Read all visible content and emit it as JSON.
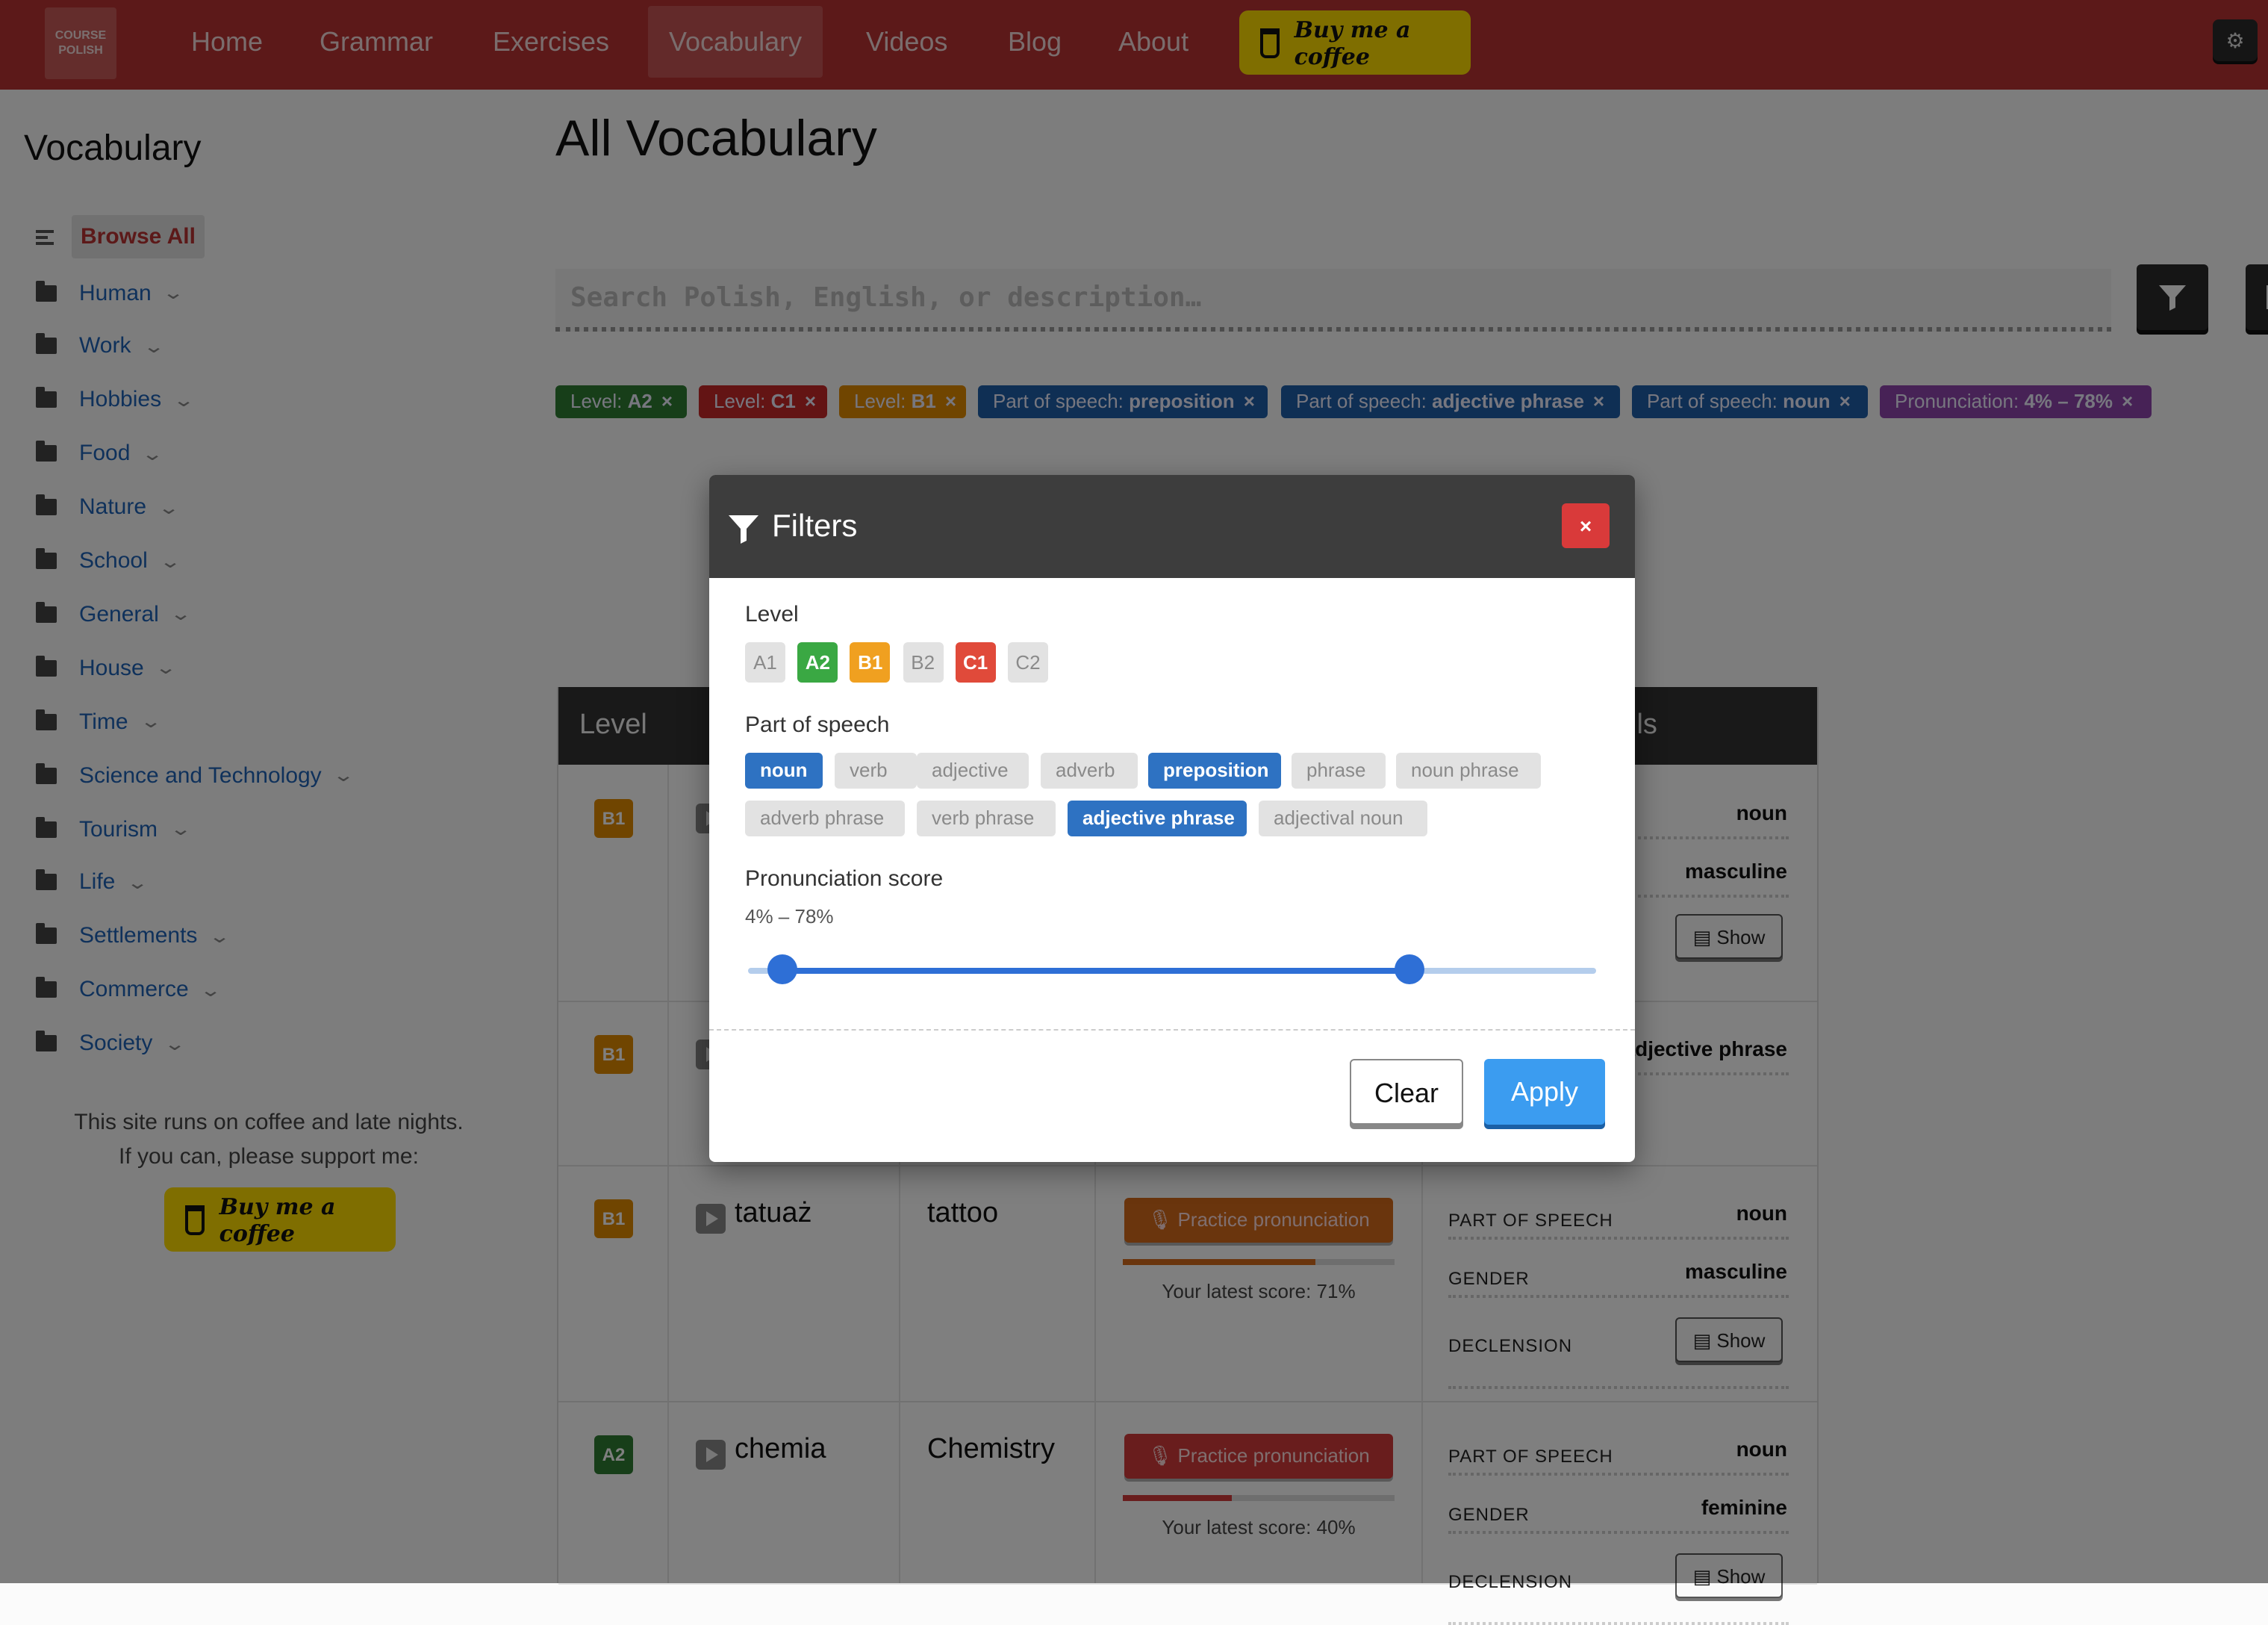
{
  "nav": {
    "logo_line1": "COURSE",
    "logo_line2": "POLISH",
    "items": [
      "Home",
      "Grammar",
      "Exercises",
      "Vocabulary",
      "Videos",
      "Blog",
      "About"
    ],
    "active": "Vocabulary",
    "coffee_label": "Buy me a coffee"
  },
  "sidebar": {
    "title": "Vocabulary",
    "browse_all": "Browse All",
    "categories": [
      "Human",
      "Work",
      "Hobbies",
      "Food",
      "Nature",
      "School",
      "General",
      "House",
      "Time",
      "Science and Technology",
      "Tourism",
      "Life",
      "Settlements",
      "Commerce",
      "Society"
    ],
    "support_line1": "This site runs on coffee and late nights.",
    "support_line2": "If you can, please support me:",
    "coffee_label": "Buy me a coffee"
  },
  "main": {
    "title": "All Vocabulary",
    "search_placeholder": "Search Polish, English, or description…"
  },
  "active_filters": [
    {
      "key": "Level: ",
      "value": "A2",
      "color": "#2e7d32"
    },
    {
      "key": "Level: ",
      "value": "C1",
      "color": "#c62828"
    },
    {
      "key": "Level: ",
      "value": "B1",
      "color": "#e08a00"
    },
    {
      "key": "Part of speech: ",
      "value": "preposition",
      "color": "#1f5fa8"
    },
    {
      "key": "Part of speech: ",
      "value": "adjective phrase",
      "color": "#1f5fa8"
    },
    {
      "key": "Part of speech: ",
      "value": "noun",
      "color": "#1f5fa8"
    },
    {
      "key": "Pronunciation: ",
      "value": "4% – 78%",
      "color": "#8e44ad"
    }
  ],
  "table": {
    "headers": {
      "level": "Level",
      "details_fragment": "ils"
    },
    "rows": [
      {
        "level": "B1",
        "level_color": "#e08a00",
        "polish": "",
        "english": "",
        "details": [
          {
            "label": "",
            "value": "noun"
          },
          {
            "label": "",
            "value": "masculine"
          }
        ],
        "show": "Show"
      },
      {
        "level": "B1",
        "level_color": "#e08a00",
        "polish": "",
        "english": "",
        "details": [
          {
            "label": "",
            "value": "adjective phrase"
          }
        ]
      },
      {
        "level": "B1",
        "level_color": "#e08a00",
        "polish": "tatuaż",
        "english": "tattoo",
        "practice": "Practice pronunciation",
        "practice_color": "#d56a1a",
        "score_fraction": 0.71,
        "score_text": "Your latest score: 71%",
        "details": [
          {
            "label": "PART OF SPEECH",
            "value": "noun"
          },
          {
            "label": "GENDER",
            "value": "masculine"
          },
          {
            "label": "DECLENSION",
            "value": ""
          }
        ],
        "show": "Show"
      },
      {
        "level": "A2",
        "level_color": "#2e7d32",
        "polish": "chemia",
        "english": "Chemistry",
        "practice": "Practice pronunciation",
        "practice_color": "#d33a3a",
        "score_fraction": 0.4,
        "score_text": "Your latest score: 40%",
        "details": [
          {
            "label": "PART OF SPEECH",
            "value": "noun"
          },
          {
            "label": "GENDER",
            "value": "feminine"
          },
          {
            "label": "DECLENSION",
            "value": ""
          }
        ],
        "show": "Show"
      }
    ]
  },
  "modal": {
    "title": "Filters",
    "close": "×",
    "level_label": "Level",
    "levels": [
      {
        "label": "A1",
        "selected": false,
        "color": "#e2e2e2"
      },
      {
        "label": "A2",
        "selected": true,
        "color": "#3aa843"
      },
      {
        "label": "B1",
        "selected": true,
        "color": "#f0a020"
      },
      {
        "label": "B2",
        "selected": false,
        "color": "#e2e2e2"
      },
      {
        "label": "C1",
        "selected": true,
        "color": "#e04a3a"
      },
      {
        "label": "C2",
        "selected": false,
        "color": "#e2e2e2"
      }
    ],
    "pos_label": "Part of speech",
    "parts_of_speech": [
      {
        "label": "noun",
        "selected": true
      },
      {
        "label": "verb",
        "selected": false
      },
      {
        "label": "adjective",
        "selected": false
      },
      {
        "label": "adverb",
        "selected": false
      },
      {
        "label": "preposition",
        "selected": true
      },
      {
        "label": "phrase",
        "selected": false
      },
      {
        "label": "noun phrase",
        "selected": false
      },
      {
        "label": "adverb phrase",
        "selected": false
      },
      {
        "label": "verb phrase",
        "selected": false
      },
      {
        "label": "adjective phrase",
        "selected": true
      },
      {
        "label": "adjectival noun",
        "selected": false
      }
    ],
    "pron_label": "Pronunciation score",
    "pron_range_text": "4% – 78%",
    "pron_min": 4,
    "pron_max": 78,
    "clear": "Clear",
    "apply": "Apply"
  }
}
